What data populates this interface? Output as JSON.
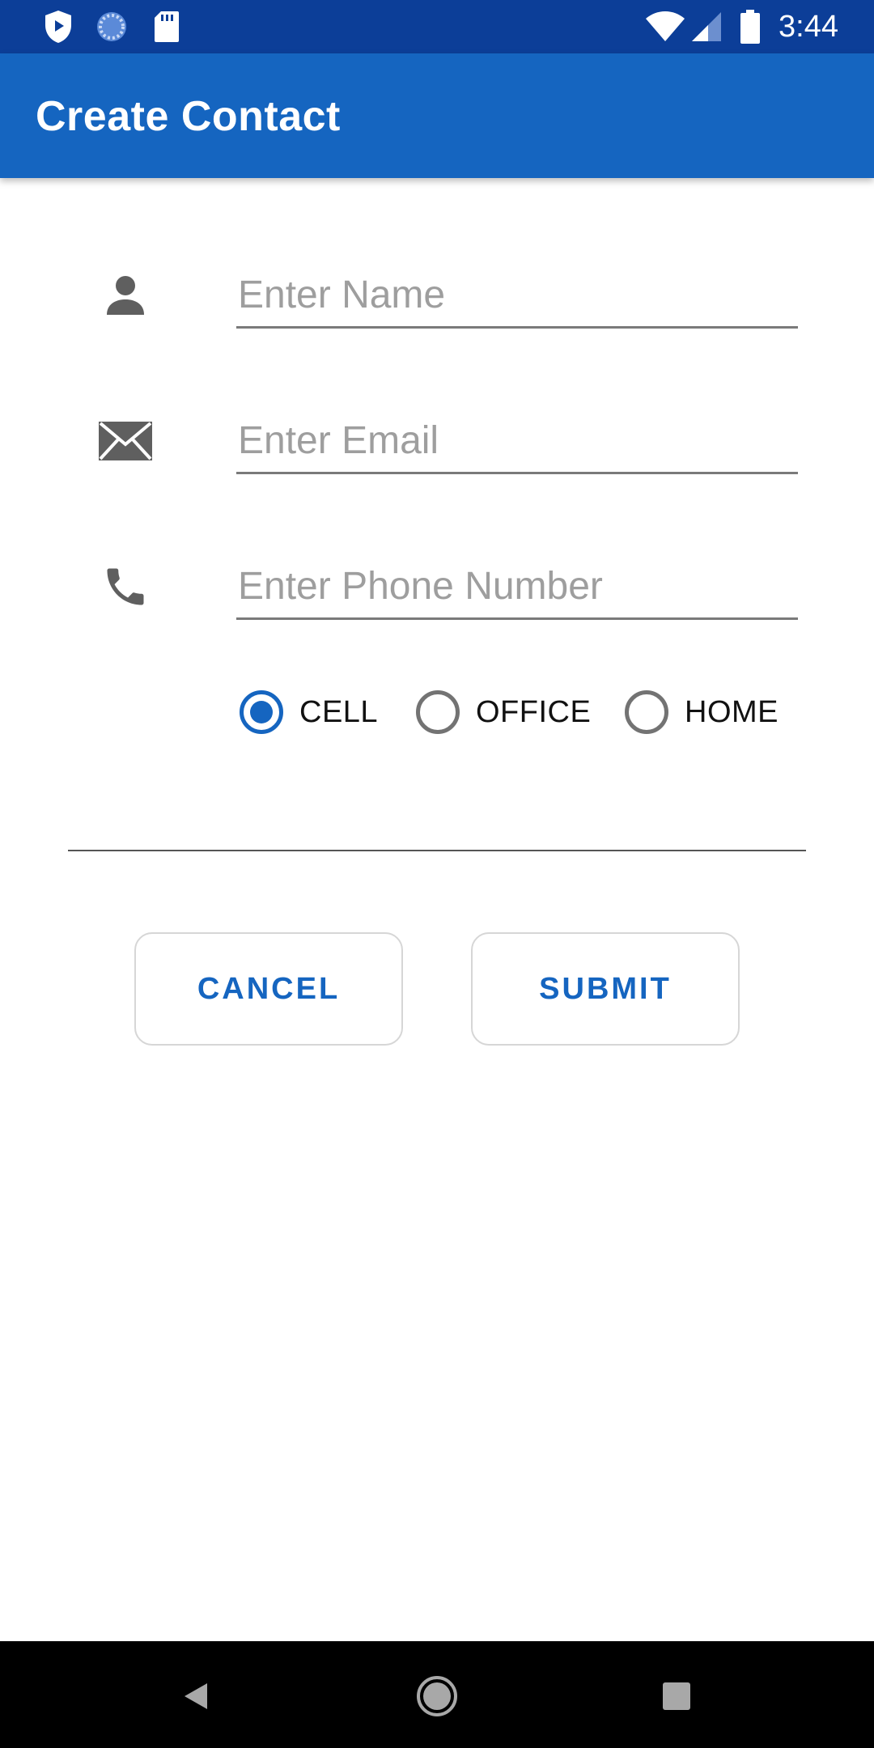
{
  "status_bar": {
    "time": "3:44",
    "left_icons": [
      "shield-play-icon",
      "loading-icon",
      "sd-card-icon"
    ],
    "right_icons": [
      "wifi-icon",
      "signal-icon",
      "battery-icon"
    ]
  },
  "app_bar": {
    "title": "Create Contact"
  },
  "form": {
    "name": {
      "icon": "person-icon",
      "placeholder": "Enter Name",
      "value": ""
    },
    "email": {
      "icon": "email-icon",
      "placeholder": "Enter Email",
      "value": ""
    },
    "phone": {
      "icon": "phone-icon",
      "placeholder": "Enter Phone Number",
      "value": ""
    },
    "phone_type": {
      "options": [
        "CELL",
        "OFFICE",
        "HOME"
      ],
      "selected": "CELL"
    }
  },
  "buttons": {
    "cancel_label": "CANCEL",
    "submit_label": "SUBMIT"
  },
  "colors": {
    "status_bar": "#0c3e98",
    "app_bar": "#1565c0",
    "accent": "#1565c0",
    "icon_gray": "#5f5f5f"
  },
  "nav_bar": {
    "items": [
      "back-icon",
      "home-icon",
      "recents-icon"
    ]
  }
}
